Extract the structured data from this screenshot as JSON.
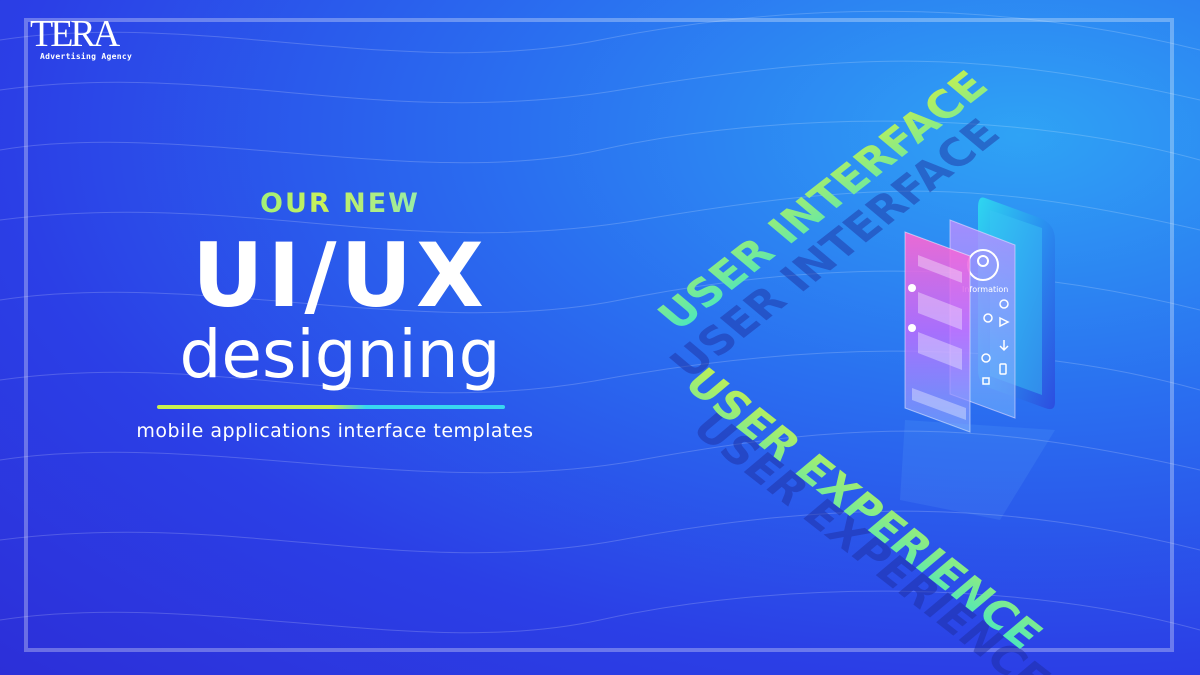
{
  "brand": {
    "logo_text": "TERA",
    "logo_subtitle": "Advertising Agency"
  },
  "headline": {
    "kicker": "OUR NEW",
    "title": "UI/UX",
    "subtitle": "designing",
    "tagline": "mobile applications interface templates"
  },
  "illustration": {
    "label_top": "USER INTERFACE",
    "label_bottom": "USER EXPERIENCE",
    "screen_caption": "Information"
  },
  "colors": {
    "background_dark": "#2c2fd8",
    "background_light": "#2fa3f5",
    "accent_lime": "#c9f04d",
    "accent_cyan": "#38d7f0",
    "accent_mint": "#5ef0b0"
  },
  "icons": [
    "profile-icon",
    "chat-icon",
    "gear-icon",
    "location-icon",
    "download-icon",
    "play-icon",
    "phone-icon"
  ]
}
